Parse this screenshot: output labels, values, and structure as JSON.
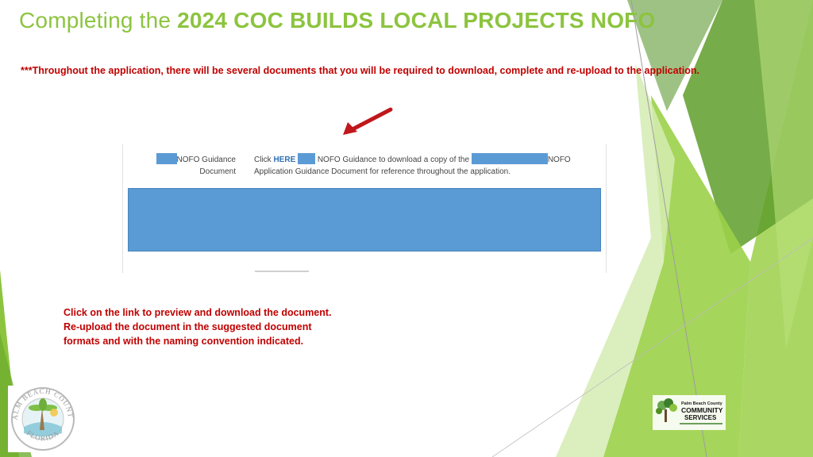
{
  "header": {
    "title_prefix": "Completing the ",
    "title_emphasis": "2024 COC BUILDS LOCAL PROJECTS NOFO"
  },
  "note": "***Throughout the application, there will be several documents that you will be required to download, complete and re-upload to the application.",
  "screenshot": {
    "label_line1": "NOFO Guidance",
    "label_line2": "Document",
    "click_text": "Click ",
    "link_text": "HERE",
    "desc_part1": "NOFO Guidance to download a copy of the",
    "desc_part2": "NOFO",
    "desc_line2": "Application Guidance Document for reference throughout the application."
  },
  "instructions": [
    "Click on the link to preview and download the document.",
    "Re-upload the document in the suggested document",
    "formats and with the naming convention indicated."
  ],
  "logos": {
    "left_text_top": "PALM BEACH COUNTY",
    "left_text_bottom": "FLORIDA",
    "right_line1": "Palm Beach County",
    "right_line2": "COMMUNITY",
    "right_line3": "SERVICES"
  },
  "colors": {
    "title": "#8cc43f",
    "note": "#c00000",
    "instructions": "#c00000",
    "arrow": "#c0171c",
    "redaction": "#5b9bd5",
    "green_light": "#9bd048",
    "green_dark": "#5e9e2a",
    "green_pale": "#d4ecb2"
  },
  "icons": {
    "arrow": "arrow-pointing-down-left-icon",
    "county_seal": "palm-beach-county-seal-logo",
    "community_services": "community-services-tree-logo"
  }
}
